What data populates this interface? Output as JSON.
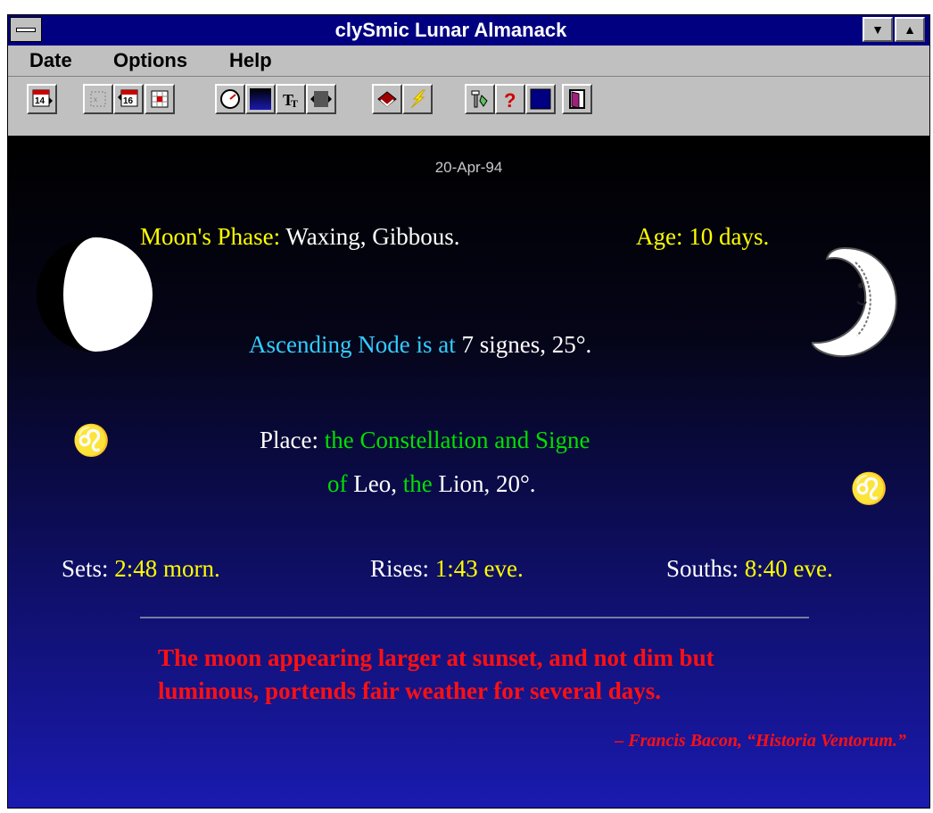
{
  "window": {
    "title": "clySmic Lunar Almanack"
  },
  "menu": {
    "items": [
      "Date",
      "Options",
      "Help"
    ]
  },
  "toolbar": {
    "icons": [
      "calendar-14-icon",
      "disabled-calendar-icon",
      "calendar-16-icon",
      "grid-calendar-icon",
      "compass-icon",
      "blue-panel-icon",
      "font-icon",
      "dotted-shape-icon",
      "book-icon",
      "lightning-icon",
      "tools-icon",
      "help-icon",
      "moon-icon",
      "exit-door-icon"
    ]
  },
  "almanac": {
    "date": "20-Apr-94",
    "phase_label": "Moon's Phase:",
    "phase_value": "Waxing, Gibbous.",
    "age_label": "Age:",
    "age_value": "10 days.",
    "node_label": "Ascending Node is at",
    "node_value": "7 signes, 25°.",
    "place_label": "Place:",
    "place_text1": "the Constellation and Signe",
    "place_of": "of",
    "place_leo": "Leo,",
    "place_the": "the",
    "place_lion": "Lion, 20°.",
    "zodiac_symbol": "♌",
    "sets_label": "Sets:",
    "sets_value": "2:48 morn.",
    "rises_label": "Rises:",
    "rises_value": "1:43 eve.",
    "souths_label": "Souths:",
    "souths_value": "8:40 eve.",
    "quote_line1": "The moon appearing larger at sunset, and not dim but",
    "quote_line2": "luminous, portends fair weather for several days.",
    "attribution": "– Francis Bacon, “Historia Ventorum.”"
  },
  "colors": {
    "title_bar": "#000080",
    "label": "#ffff00",
    "node": "#33ccff",
    "place": "#00e000",
    "zodiac": "#ff33ff",
    "quote": "#ff1010"
  }
}
